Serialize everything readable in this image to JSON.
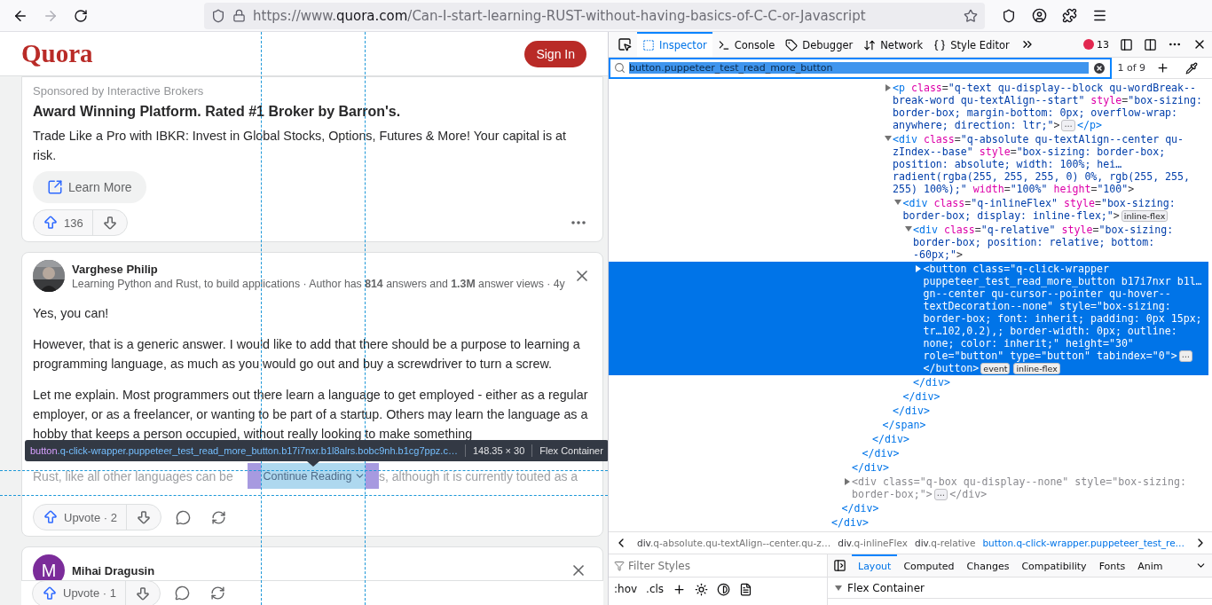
{
  "browser": {
    "back_disabled": false,
    "forward_disabled": true,
    "url": {
      "prefix": "https://www.",
      "domain": "quora.com",
      "path": "/Can-I-start-learning-RUST-without-having-basics-of-C-C-or-Javascript"
    }
  },
  "page": {
    "logo": "Quora",
    "sign_in": "Sign In",
    "ad": {
      "sponsor": "Sponsored by Interactive Brokers",
      "title": "Award Winning Platform. Rated #1 Broker by Barron's.",
      "body": "Trade Like a Pro with IBKR: Invest in Global Stocks, Options, Futures & More! Your capital is at risk.",
      "cta": "Learn More",
      "upvotes": "136"
    },
    "answer": {
      "author": "Varghese Philip",
      "credentials": "Learning Python and Rust, to build applications · Author has **814** answers and **1.3M** answer views · 4y",
      "paragraphs": [
        "Yes, you can!",
        "However, that is a generic answer. I would like to add that there should be a purpose to learning a programming language, as much as you would go out and buy a screwdriver to turn a screw.",
        "Let me explain. Most programmers out there learn a language to get employed - either as a regular employer, or as a freelancer, or wanting to be part of a startup. Others may learn the language as a hobby that keeps a person occupied, without really looking to make something"
      ],
      "faded_before": "Rust, like all other languages can be ",
      "faded_after": "s, although it is currently touted as a",
      "read_more": "Continue Reading",
      "upvote": "Upvote · 2"
    },
    "next_answer": {
      "avatar_letter": "M",
      "author": "Mihai Dragusin",
      "upvote": "Upvote · 1"
    },
    "tooltip": {
      "tag": "button",
      "classes": ".q-click-wrapper.puppeteer_test_read_more_button.b17i7nxr.b1l8alrs.bobc9nh.b1cg7ppz.c…",
      "size": "148.35 × 30",
      "type": "Flex Container"
    }
  },
  "devtools": {
    "tabs": [
      {
        "label": "Inspector",
        "kind": "inspector",
        "selected": true
      },
      {
        "label": "Console",
        "kind": "console",
        "selected": false
      },
      {
        "label": "Debugger",
        "kind": "debugger",
        "selected": false
      },
      {
        "label": "Network",
        "kind": "network",
        "selected": false
      },
      {
        "label": "Style Editor",
        "kind": "style",
        "selected": false
      }
    ],
    "error_count": "13",
    "search": {
      "value": "button.puppeteer_test_read_more_button",
      "result": "1 of 9"
    },
    "markup": {
      "close": "</div>",
      "children": [
        {
          "close": "</div>",
          "children": [
            {
              "close": "</div>",
              "children": [
                {
                  "close": "</div>",
                  "children": [
                    {
                      "close": "</div>",
                      "children": [
                        {
                          "close": "</span>",
                          "children": [
                            {
                              "selected": false,
                              "expanded": false,
                              "hidden": false,
                              "segments": [
                                {
                                  "kind": "tag",
                                  "s": "<p"
                                },
                                {
                                  "kind": "attr",
                                  "s": " class"
                                },
                                {
                                  "kind": "punct",
                                  "s": "="
                                },
                                {
                                  "kind": "value",
                                  "s": "\"q-text qu-display--block qu-wordBreak--break-word qu-textAlign--start\""
                                },
                                {
                                  "kind": "attr",
                                  "s": " style"
                                },
                                {
                                  "kind": "punct",
                                  "s": "="
                                },
                                {
                                  "kind": "value",
                                  "s": "\"box-sizing: border-box; margin-bottom: 0px; overflow-wrap: anywhere; direction: ltr;\""
                                },
                                {
                                  "kind": "punct",
                                  "s": ">"
                                },
                                {
                                  "kind": "more",
                                  "s": "⋯"
                                },
                                {
                                  "kind": "tag",
                                  "s": "</p>"
                                }
                              ]
                            },
                            {
                              "selected": false,
                              "expanded": true,
                              "hidden": false,
                              "close": "</div>",
                              "segments": [
                                {
                                  "kind": "tag",
                                  "s": "<div"
                                },
                                {
                                  "kind": "attr",
                                  "s": " class"
                                },
                                {
                                  "kind": "punct",
                                  "s": "="
                                },
                                {
                                  "kind": "value",
                                  "s": "\"q-absolute qu-textAlign--center qu-zIndex--base\""
                                },
                                {
                                  "kind": "attr",
                                  "s": " style"
                                },
                                {
                                  "kind": "punct",
                                  "s": "="
                                },
                                {
                                  "kind": "value",
                                  "s": "\"box-sizing: border-box; position: absolute; width: 100%; hei…radient(rgba(255, 255, 255, 0) 0%, rgb(255, 255, 255) 100%);\""
                                },
                                {
                                  "kind": "attr",
                                  "s": " width"
                                },
                                {
                                  "kind": "punct",
                                  "s": "="
                                },
                                {
                                  "kind": "value",
                                  "s": "\"100%\""
                                },
                                {
                                  "kind": "attr",
                                  "s": " height"
                                },
                                {
                                  "kind": "punct",
                                  "s": "="
                                },
                                {
                                  "kind": "value",
                                  "s": "\"100\""
                                },
                                {
                                  "kind": "punct",
                                  "s": ">"
                                }
                              ],
                              "children": [
                                {
                                  "selected": false,
                                  "expanded": true,
                                  "hidden": false,
                                  "close": "</div>",
                                  "segments": [
                                    {
                                      "kind": "tag",
                                      "s": "<div"
                                    },
                                    {
                                      "kind": "attr",
                                      "s": " class"
                                    },
                                    {
                                      "kind": "punct",
                                      "s": "="
                                    },
                                    {
                                      "kind": "value",
                                      "s": "\"q-inlineFlex\""
                                    },
                                    {
                                      "kind": "attr",
                                      "s": " style"
                                    },
                                    {
                                      "kind": "punct",
                                      "s": "="
                                    },
                                    {
                                      "kind": "value",
                                      "s": "\"box-sizing: border-box; display: inline-flex;\""
                                    },
                                    {
                                      "kind": "punct",
                                      "s": ">"
                                    },
                                    {
                                      "kind": "badge",
                                      "s": "inline-flex"
                                    }
                                  ],
                                  "children": [
                                    {
                                      "selected": false,
                                      "expanded": true,
                                      "hidden": false,
                                      "close": "</div>",
                                      "segments": [
                                        {
                                          "kind": "tag",
                                          "s": "<div"
                                        },
                                        {
                                          "kind": "attr",
                                          "s": " class"
                                        },
                                        {
                                          "kind": "punct",
                                          "s": "="
                                        },
                                        {
                                          "kind": "value",
                                          "s": "\"q-relative\""
                                        },
                                        {
                                          "kind": "attr",
                                          "s": " style"
                                        },
                                        {
                                          "kind": "punct",
                                          "s": "="
                                        },
                                        {
                                          "kind": "value",
                                          "s": "\"box-sizing: border-box; position: relative; bottom: -60px;\""
                                        },
                                        {
                                          "kind": "punct",
                                          "s": ">"
                                        }
                                      ],
                                      "children": [
                                        {
                                          "selected": true,
                                          "expanded": false,
                                          "hidden": false,
                                          "segments": [
                                            {
                                              "kind": "tag",
                                              "s": "<button"
                                            },
                                            {
                                              "kind": "attr",
                                              "s": " class"
                                            },
                                            {
                                              "kind": "punct",
                                              "s": "="
                                            },
                                            {
                                              "kind": "value",
                                              "s": "\"q-click-wrapper puppeteer_test_read_more_button b17i7nxr b1l…gn--center qu-cursor--pointer qu-hover--textDecoration--none\""
                                            },
                                            {
                                              "kind": "attr",
                                              "s": " style"
                                            },
                                            {
                                              "kind": "punct",
                                              "s": "="
                                            },
                                            {
                                              "kind": "value",
                                              "s": "\"box-sizing: border-box; font: inherit; padding: 0px 15px; tr…102,0.2),; border-width: 0px; outline: none; color: inherit;\""
                                            },
                                            {
                                              "kind": "attr",
                                              "s": " height"
                                            },
                                            {
                                              "kind": "punct",
                                              "s": "="
                                            },
                                            {
                                              "kind": "value",
                                              "s": "\"30\""
                                            },
                                            {
                                              "kind": "attr",
                                              "s": " role"
                                            },
                                            {
                                              "kind": "punct",
                                              "s": "="
                                            },
                                            {
                                              "kind": "value",
                                              "s": "\"button\""
                                            },
                                            {
                                              "kind": "attr",
                                              "s": " type"
                                            },
                                            {
                                              "kind": "punct",
                                              "s": "="
                                            },
                                            {
                                              "kind": "value",
                                              "s": "\"button\""
                                            },
                                            {
                                              "kind": "attr",
                                              "s": " tabindex"
                                            },
                                            {
                                              "kind": "punct",
                                              "s": "="
                                            },
                                            {
                                              "kind": "value",
                                              "s": "\"0\""
                                            },
                                            {
                                              "kind": "punct",
                                              "s": ">"
                                            },
                                            {
                                              "kind": "more",
                                              "s": "⋯"
                                            },
                                            {
                                              "kind": "tag",
                                              "s": "</button>"
                                            },
                                            {
                                              "kind": "badge",
                                              "s": "event"
                                            },
                                            {
                                              "kind": "badge",
                                              "s": "inline-flex"
                                            }
                                          ]
                                        }
                                      ]
                                    }
                                  ]
                                }
                              ]
                            }
                          ]
                        }
                      ]
                    }
                  ]
                }
              ]
            },
            {
              "selected": false,
              "expanded": false,
              "hidden": true,
              "segments": [
                {
                  "kind": "tag",
                  "s": "<div"
                },
                {
                  "kind": "attr",
                  "s": " class"
                },
                {
                  "kind": "punct",
                  "s": "="
                },
                {
                  "kind": "value",
                  "s": "\"q-box qu-display--none\""
                },
                {
                  "kind": "attr",
                  "s": " style"
                },
                {
                  "kind": "punct",
                  "s": "="
                },
                {
                  "kind": "value",
                  "s": "\"box-sizing: border-box;\""
                },
                {
                  "kind": "punct",
                  "s": ">"
                },
                {
                  "kind": "more",
                  "s": "⋯"
                },
                {
                  "kind": "tag",
                  "s": "</div>"
                }
              ]
            }
          ]
        }
      ]
    },
    "breadcrumbs": [
      {
        "tag": "div",
        "classes": ".q-absolute.qu-textAlign--center.qu-z…",
        "selected": false
      },
      {
        "tag": "div",
        "classes": ".q-inlineFlex",
        "selected": false
      },
      {
        "tag": "div",
        "classes": ".q-relative",
        "selected": false
      },
      {
        "tag": "button",
        "classes": ".q-click-wrapper.puppeteer_test_re…",
        "selected": true
      }
    ],
    "styles": {
      "filter_placeholder": "Filter Styles",
      "hov": ":hov",
      "cls": ".cls"
    },
    "side_tabs": [
      {
        "label": "Layout",
        "selected": true
      },
      {
        "label": "Computed",
        "selected": false
      },
      {
        "label": "Changes",
        "selected": false
      },
      {
        "label": "Compatibility",
        "selected": false
      },
      {
        "label": "Fonts",
        "selected": false
      },
      {
        "label": "Anim",
        "selected": false
      }
    ],
    "section": "Flex Container"
  }
}
